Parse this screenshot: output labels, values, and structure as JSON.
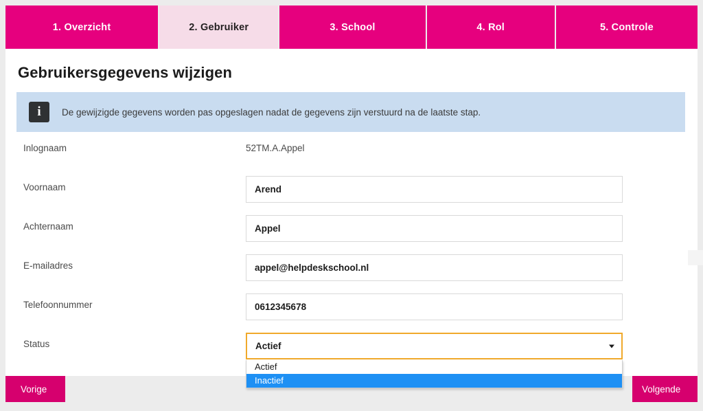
{
  "wizard": {
    "tabs": [
      {
        "label": "1. Overzicht",
        "active": false
      },
      {
        "label": "2. Gebruiker",
        "active": true
      },
      {
        "label": "3. School",
        "active": false
      },
      {
        "label": "4. Rol",
        "active": false
      },
      {
        "label": "5. Controle",
        "active": false
      }
    ],
    "accent_color": "#e6007e",
    "active_tab_color": "#f6dce8"
  },
  "page": {
    "title": "Gebruikersgegevens wijzigen"
  },
  "info_banner": {
    "icon": "info-icon",
    "text": "De gewijzigde gegevens worden pas opgeslagen nadat de gegevens zijn verstuurd na de laatste stap.",
    "background_color": "#c9dcf0"
  },
  "form": {
    "fields": [
      {
        "label": "Inlognaam",
        "value": "52TM.A.Appel",
        "type": "static"
      },
      {
        "label": "Voornaam",
        "value": "Arend",
        "type": "text"
      },
      {
        "label": "Achternaam",
        "value": "Appel",
        "type": "text"
      },
      {
        "label": "E-mailadres",
        "value": "appel@helpdeskschool.nl",
        "type": "text"
      },
      {
        "label": "Telefoonnummer",
        "value": "0612345678",
        "type": "text"
      },
      {
        "label": "Status",
        "value": "Actief",
        "type": "select"
      }
    ],
    "status_select": {
      "label": "Status",
      "value": "Actief",
      "expanded": true,
      "focus_border_color": "#f0a92b",
      "highlight_color": "#1e90f4",
      "options": [
        {
          "label": "Actief",
          "highlighted": false
        },
        {
          "label": "Inactief",
          "highlighted": true
        }
      ]
    }
  },
  "footer": {
    "previous_label": "Vorige",
    "next_label": "Volgende",
    "button_color": "#d6006e"
  }
}
